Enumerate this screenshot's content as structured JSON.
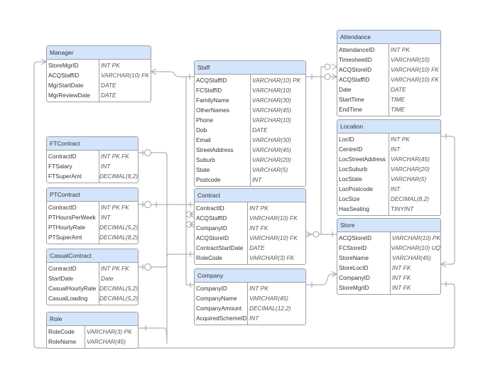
{
  "entities": [
    {
      "id": "manager",
      "name": "Manager",
      "split": 73,
      "fields": [
        [
          "StoreMgrID",
          "INT PK"
        ],
        [
          "ACQStaffID",
          "VARCHAR(10) FK"
        ],
        [
          "MgrStartDate",
          "DATE"
        ],
        [
          "MgrReviewDate",
          "DATE"
        ]
      ]
    },
    {
      "id": "staff",
      "name": "Staff",
      "split": 78,
      "fields": [
        [
          "ACQStaffID",
          "VARCHAR(10) PK"
        ],
        [
          "FCStaffID",
          "VARCHAR(10)"
        ],
        [
          "FamilyName",
          "VARCHAR(30)"
        ],
        [
          "OtherNames",
          "VARCHAR(45)"
        ],
        [
          "Phone",
          "VARCHAR(10)"
        ],
        [
          "Dob",
          "DATE"
        ],
        [
          "Email",
          "VARCHAR(30)"
        ],
        [
          "StreetAddress",
          "VARCHAR(45)"
        ],
        [
          "Suburb",
          "VARCHAR(20)"
        ],
        [
          "State",
          "VARCHAR(5)"
        ],
        [
          "Postcode",
          "INT"
        ]
      ]
    },
    {
      "id": "attendance",
      "name": "Attendance",
      "split": 72,
      "fields": [
        [
          "AttendanceID",
          "INT PK"
        ],
        [
          "TimesheetID",
          "VARCHAR(10)"
        ],
        [
          "ACQStoreID",
          "VARCHAR(10) FK"
        ],
        [
          "ACQStaffID",
          "VARCHAR(10) FK"
        ],
        [
          "Date",
          "DATE"
        ],
        [
          "StartTime",
          "TIME"
        ],
        [
          "EndTime",
          "TIME"
        ]
      ]
    },
    {
      "id": "location",
      "name": "Location",
      "split": 72,
      "fields": [
        [
          "LocID",
          "INT PK"
        ],
        [
          "CentreID",
          "INT"
        ],
        [
          "LocStreetAddress",
          "VARCHAR(45)"
        ],
        [
          "LocSuburb",
          "VARCHAR(20)"
        ],
        [
          "LocState",
          "VARCHAR(5)"
        ],
        [
          "LocPostcode",
          "INT"
        ],
        [
          "LocSize",
          "DECIMAL(8,2)"
        ],
        [
          "HasSeating",
          "TINYINT"
        ]
      ]
    },
    {
      "id": "store",
      "name": "Store",
      "split": 74,
      "fields": [
        [
          "ACQStoreID",
          "VARCHAR(10) PK"
        ],
        [
          "FCStoreID",
          "VARCHAR(10) UQ"
        ],
        [
          "StoreName",
          "VARCHAR(45)"
        ],
        [
          "StoreLocID",
          "INT FK"
        ],
        [
          "CompanyID",
          "INT FK"
        ],
        [
          "StoreMgrID",
          "INT FK"
        ]
      ]
    },
    {
      "id": "ftcontract",
      "name": "FTContract",
      "split": 73,
      "fields": [
        [
          "ContractID",
          "INT PK FK"
        ],
        [
          "FTSalary",
          "INT"
        ],
        [
          "FTSuperAmt",
          "DECIMAL(8,2)"
        ]
      ]
    },
    {
      "id": "ptcontract",
      "name": "PTContract",
      "split": 73,
      "fields": [
        [
          "ContractID",
          "INT PK FK"
        ],
        [
          "PTHoursPerWeek",
          "INT"
        ],
        [
          "PTHourlyRate",
          "DECIMAL(5,2)"
        ],
        [
          "PTSuperAmt",
          "DECIMAL(8,2)"
        ]
      ]
    },
    {
      "id": "casualcontract",
      "name": "CasualContract",
      "split": 73,
      "fields": [
        [
          "ContractID",
          "INT PK FK"
        ],
        [
          "StartDate",
          "Date"
        ],
        [
          "CasualHourlyRate",
          "DECIMAL(5,2)"
        ],
        [
          "CasualLoading",
          "DECIMAL(5,2)"
        ]
      ]
    },
    {
      "id": "role",
      "name": "Role",
      "split": 53,
      "fields": [
        [
          "RoleCode",
          "VARCHAR(3) PK"
        ],
        [
          "RoleName",
          "VARCHAR(45)"
        ]
      ]
    },
    {
      "id": "contract",
      "name": "Contract",
      "split": 74,
      "fields": [
        [
          "ContractID",
          "INT PK"
        ],
        [
          "ACQStaffID",
          "VARCHAR(10) FK"
        ],
        [
          "CompanyID",
          "INT FK"
        ],
        [
          "ACQStoreID",
          "VARCHAR(10) FK"
        ],
        [
          "ContractStartDate",
          "DATE"
        ],
        [
          "RoleCode",
          "VARCHAR(3) FK"
        ]
      ]
    },
    {
      "id": "company",
      "name": "Company",
      "split": 74,
      "fields": [
        [
          "CompanyID",
          "INT PK"
        ],
        [
          "CompanyName",
          "VARCHAR(45)"
        ],
        [
          "CompanyAmount",
          "DECIMAL(12,2)"
        ],
        [
          "AcquiredSchemeID",
          "INT"
        ]
      ]
    }
  ]
}
